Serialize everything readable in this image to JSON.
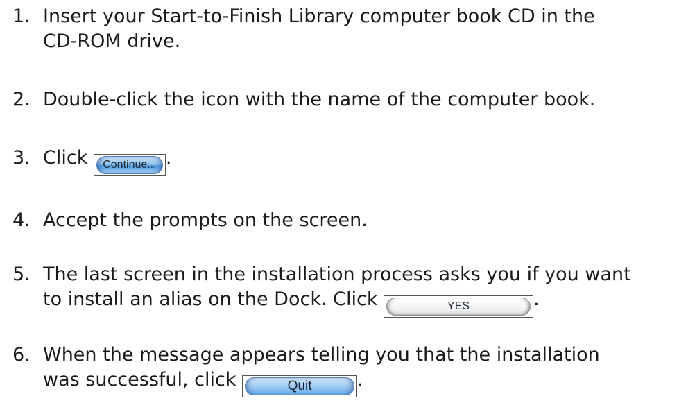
{
  "steps": [
    {
      "number": "1.",
      "line1": "Insert your Start-to-Finish Library computer book CD in the",
      "line2": "CD-ROM drive."
    },
    {
      "number": "2.",
      "line1": "Double-click the icon with the name of the computer book."
    },
    {
      "number": "3.",
      "text_before": "Click ",
      "button_label": "Continue...",
      "text_after": "."
    },
    {
      "number": "4.",
      "line1": "Accept the prompts on the screen."
    },
    {
      "number": "5.",
      "line1": "The last screen in the installation process asks you if you want",
      "line2_before": "to install an alias on the Dock. Click ",
      "button_label": "YES",
      "text_after": "."
    },
    {
      "number": "6.",
      "line1": "When the message appears telling you that the installation",
      "line2_before": "was successful, click ",
      "button_label": "Quit",
      "text_after": "."
    }
  ]
}
